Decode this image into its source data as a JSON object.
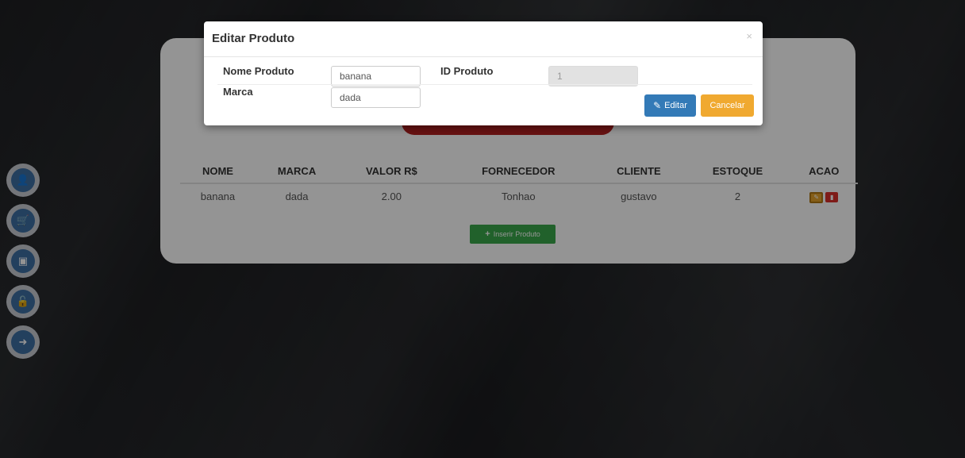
{
  "sidebar": {
    "items": [
      {
        "icon": "user-icon",
        "glyph": "👤"
      },
      {
        "icon": "cart-icon",
        "glyph": "🛒"
      },
      {
        "icon": "archive-icon",
        "glyph": "▣"
      },
      {
        "icon": "unlock-icon",
        "glyph": "🔓"
      },
      {
        "icon": "logout-icon",
        "glyph": "➜"
      }
    ]
  },
  "table": {
    "headers": [
      "NOME",
      "MARCA",
      "VALOR R$",
      "FORNECEDOR",
      "CLIENTE",
      "ESTOQUE",
      "ACAO"
    ],
    "rows": [
      {
        "nome": "banana",
        "marca": "dada",
        "valor": "2.00",
        "fornecedor": "Tonhao",
        "cliente": "gustavo",
        "estoque": "2"
      }
    ]
  },
  "insert_button": {
    "label": "Inserir Produto",
    "icon": "plus-icon"
  },
  "modal": {
    "title": "Editar Produto",
    "close_glyph": "×",
    "nome_label": "Nome Produto",
    "nome_value": "banana",
    "id_label": "ID Produto",
    "id_value": "1",
    "marca_label": "Marca",
    "marca_value": "dada",
    "editar_label": "Editar",
    "cancelar_label": "Cancelar"
  },
  "colors": {
    "primary": "#337ab7",
    "warning": "#f0a930",
    "danger": "#d9302a",
    "success": "#39a84a",
    "accent_red": "#b31f1f"
  }
}
